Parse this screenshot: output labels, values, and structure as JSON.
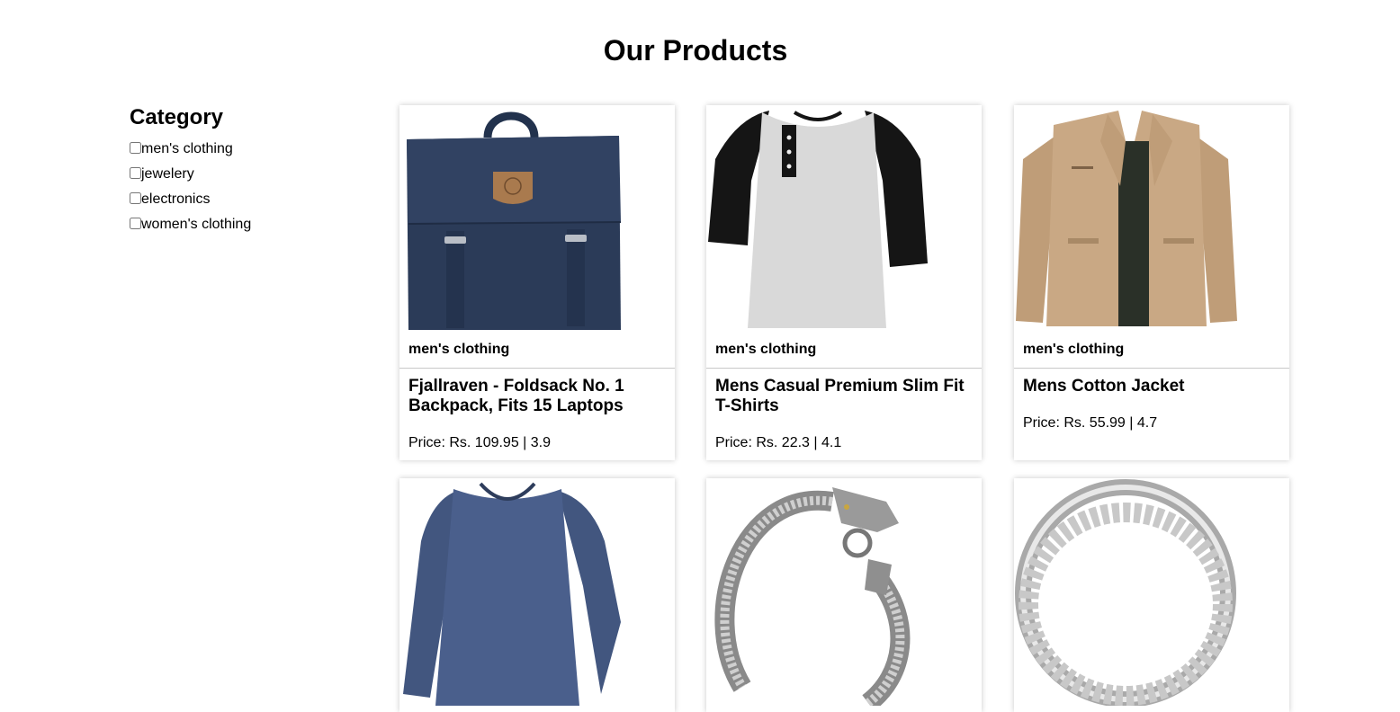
{
  "page": {
    "title": "Our Products"
  },
  "sidebar": {
    "heading": "Category",
    "categories": [
      {
        "label": "men's clothing",
        "checked": false
      },
      {
        "label": "jewelery",
        "checked": false
      },
      {
        "label": "electronics",
        "checked": false
      },
      {
        "label": "women's clothing",
        "checked": false
      }
    ]
  },
  "products": [
    {
      "category": "men's clothing",
      "name": "Fjallraven - Foldsack No. 1 Backpack, Fits 15 Laptops",
      "price_line": "Price: Rs. 109.95 | 3.9",
      "image_icon": "backpack-image"
    },
    {
      "category": "men's clothing",
      "name": "Mens Casual Premium Slim Fit T-Shirts",
      "price_line": "Price: Rs. 22.3 | 4.1",
      "image_icon": "raglan-tshirt-image"
    },
    {
      "category": "men's clothing",
      "name": "Mens Cotton Jacket",
      "price_line": "Price: Rs. 55.99 | 4.7",
      "image_icon": "cotton-jacket-image"
    },
    {
      "image_icon": "long-sleeve-shirt-image"
    },
    {
      "image_icon": "dragon-bracelet-image"
    },
    {
      "image_icon": "silver-ring-image"
    }
  ],
  "colors": {
    "backpack": "#2b3b58",
    "jacket": "#c9a884",
    "longsleeve": "#4a5f8c"
  }
}
